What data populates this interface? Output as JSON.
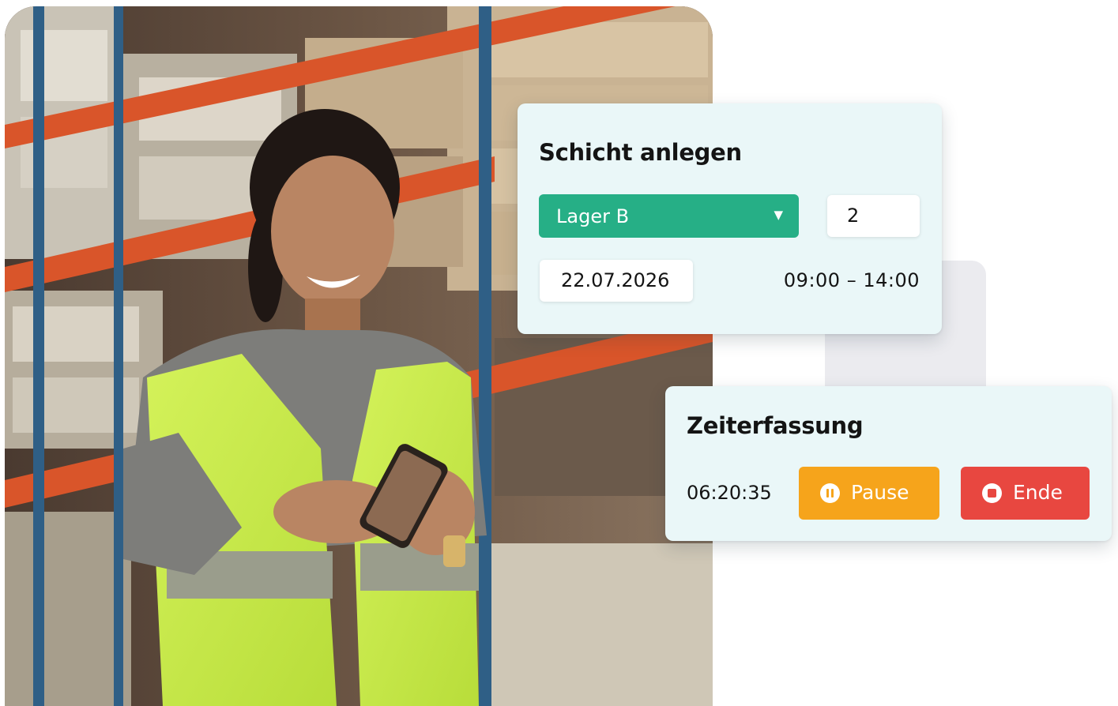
{
  "shift_card": {
    "title": "Schicht anlegen",
    "location_select": {
      "selected": "Lager B"
    },
    "headcount": "2",
    "date": "22.07.2026",
    "time_range": "09:00 – 14:00",
    "accent_color": "#26af86"
  },
  "time_card": {
    "title": "Zeiterfassung",
    "elapsed": "06:20:35",
    "pause_label": "Pause",
    "end_label": "Ende",
    "pause_color": "#f6a41b",
    "end_color": "#e84740",
    "pause_icon": "pause-circle-icon",
    "end_icon": "stop-circle-icon"
  },
  "card_background": "#eaf7f8"
}
